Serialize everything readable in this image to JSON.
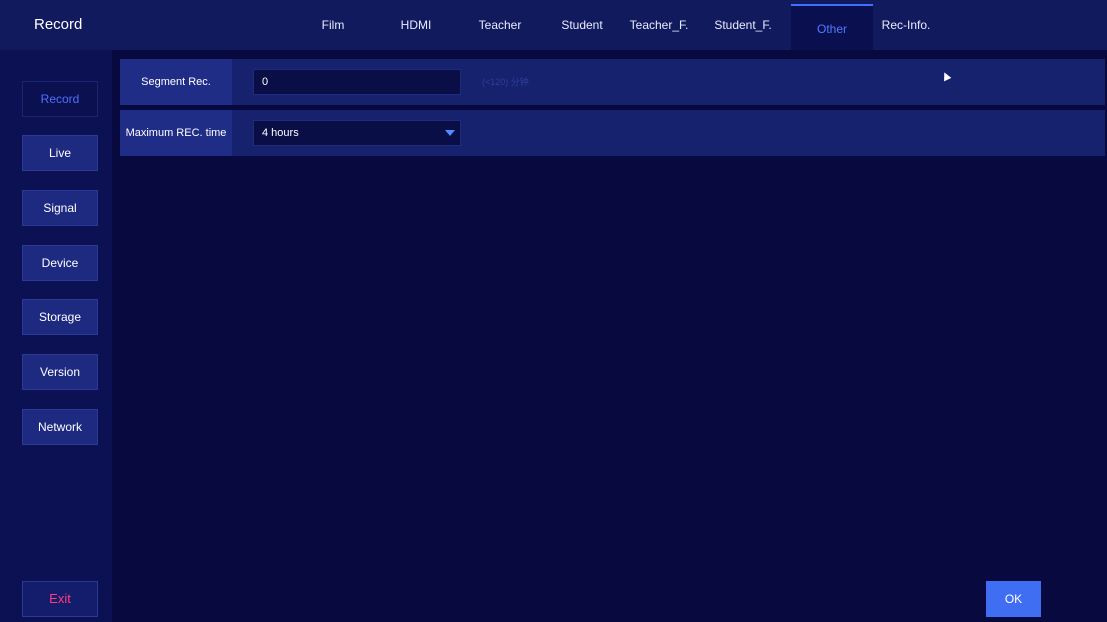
{
  "app": {
    "title": "Record"
  },
  "tabs": [
    {
      "label": "Film"
    },
    {
      "label": "HDMI"
    },
    {
      "label": "Teacher"
    },
    {
      "label": "Student"
    },
    {
      "label": "Teacher_F."
    },
    {
      "label": "Student_F."
    },
    {
      "label": "Other",
      "active": true
    },
    {
      "label": "Rec-Info."
    }
  ],
  "sidebar": {
    "items": [
      {
        "label": "Record",
        "active": true
      },
      {
        "label": "Live"
      },
      {
        "label": "Signal"
      },
      {
        "label": "Device"
      },
      {
        "label": "Storage"
      },
      {
        "label": "Version"
      },
      {
        "label": "Network"
      }
    ],
    "exit_label": "Exit"
  },
  "settings": {
    "segment": {
      "label": "Segment Rec.",
      "value": "0",
      "hint": "(<120) 分钟"
    },
    "max_time": {
      "label": "Maximum REC. time",
      "value": "4 hours"
    }
  },
  "footer": {
    "ok_label": "OK"
  },
  "colors": {
    "accent": "#3f6ef2",
    "active_tab_text": "#4f7bff",
    "exit_text": "#ff3b7b"
  }
}
